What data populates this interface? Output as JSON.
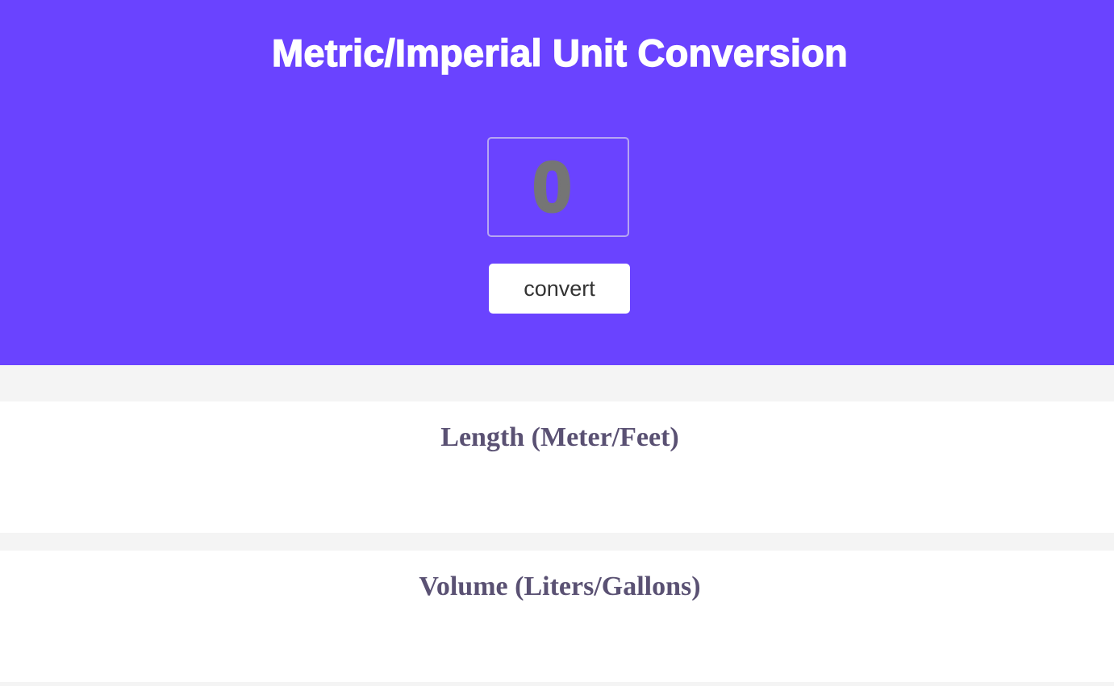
{
  "header": {
    "title": "Metric/Imperial Unit Conversion",
    "input_placeholder": "0",
    "convert_label": "convert"
  },
  "sections": [
    {
      "title": "Length (Meter/Feet)"
    },
    {
      "title": "Volume (Liters/Gallons)"
    }
  ],
  "colors": {
    "brand": "#6a43ff",
    "page_background": "#f4f4f4",
    "card_background": "#ffffff",
    "section_title": "#5a5173",
    "placeholder": "#757575"
  }
}
